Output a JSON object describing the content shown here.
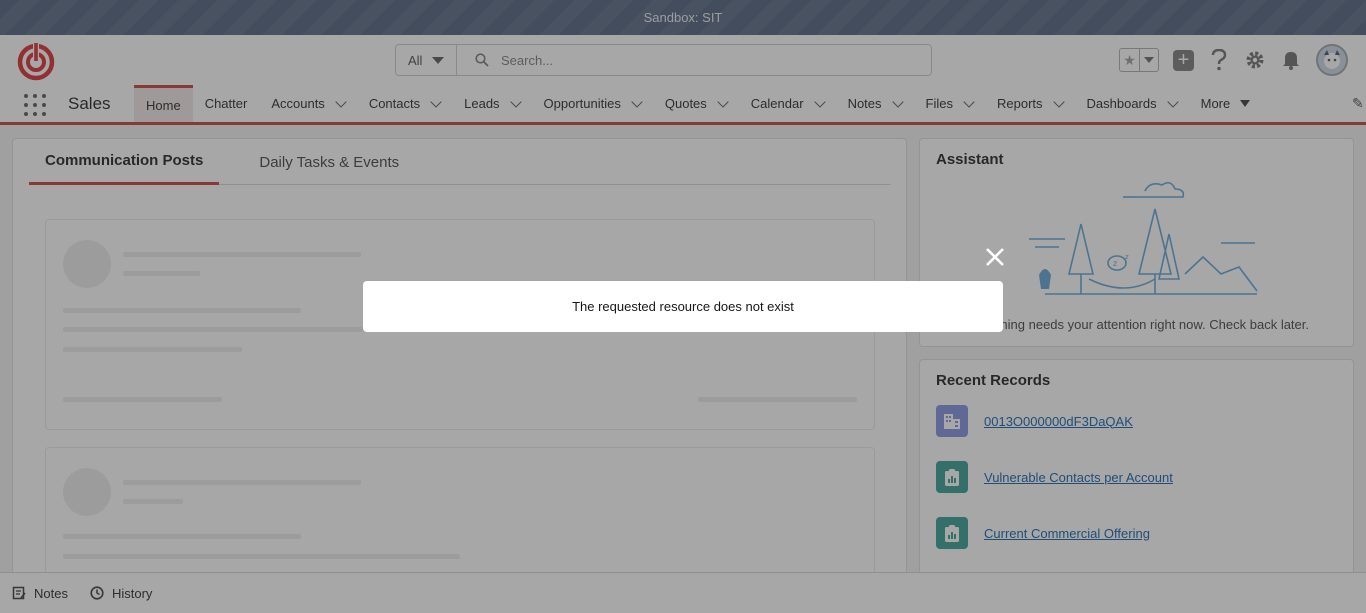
{
  "sandbox": {
    "label": "Sandbox: SIT"
  },
  "search": {
    "scope": "All",
    "placeholder": "Search..."
  },
  "app": {
    "name": "Sales"
  },
  "nav": {
    "items": [
      {
        "label": "Home",
        "active": true,
        "menu": false
      },
      {
        "label": "Chatter",
        "active": false,
        "menu": false
      },
      {
        "label": "Accounts",
        "active": false,
        "menu": true
      },
      {
        "label": "Contacts",
        "active": false,
        "menu": true
      },
      {
        "label": "Leads",
        "active": false,
        "menu": true
      },
      {
        "label": "Opportunities",
        "active": false,
        "menu": true
      },
      {
        "label": "Quotes",
        "active": false,
        "menu": true
      },
      {
        "label": "Calendar",
        "active": false,
        "menu": true
      },
      {
        "label": "Notes",
        "active": false,
        "menu": true
      },
      {
        "label": "Files",
        "active": false,
        "menu": true
      },
      {
        "label": "Reports",
        "active": false,
        "menu": true
      },
      {
        "label": "Dashboards",
        "active": false,
        "menu": true
      }
    ],
    "more_label": "More"
  },
  "tabs": {
    "communication": "Communication Posts",
    "tasks": "Daily Tasks & Events"
  },
  "assistant": {
    "title": "Assistant",
    "message": "Nothing needs your attention right now. Check back later."
  },
  "recent": {
    "title": "Recent Records",
    "items": [
      {
        "label": "0013O000000dF3DaQAK",
        "icon": "account-icon",
        "color": "#7f8de1"
      },
      {
        "label": "Vulnerable Contacts per Account",
        "icon": "report-icon",
        "color": "#2e9c8e"
      },
      {
        "label": "Current Commercial Offering",
        "icon": "report-icon",
        "color": "#2e9c8e"
      }
    ]
  },
  "utility": {
    "notes": "Notes",
    "history": "History"
  },
  "modal": {
    "message": "The requested resource does not exist"
  },
  "colors": {
    "brand_red": "#c23934",
    "link": "#0b5cab",
    "sandbox_bar": "#4a5c7a"
  }
}
